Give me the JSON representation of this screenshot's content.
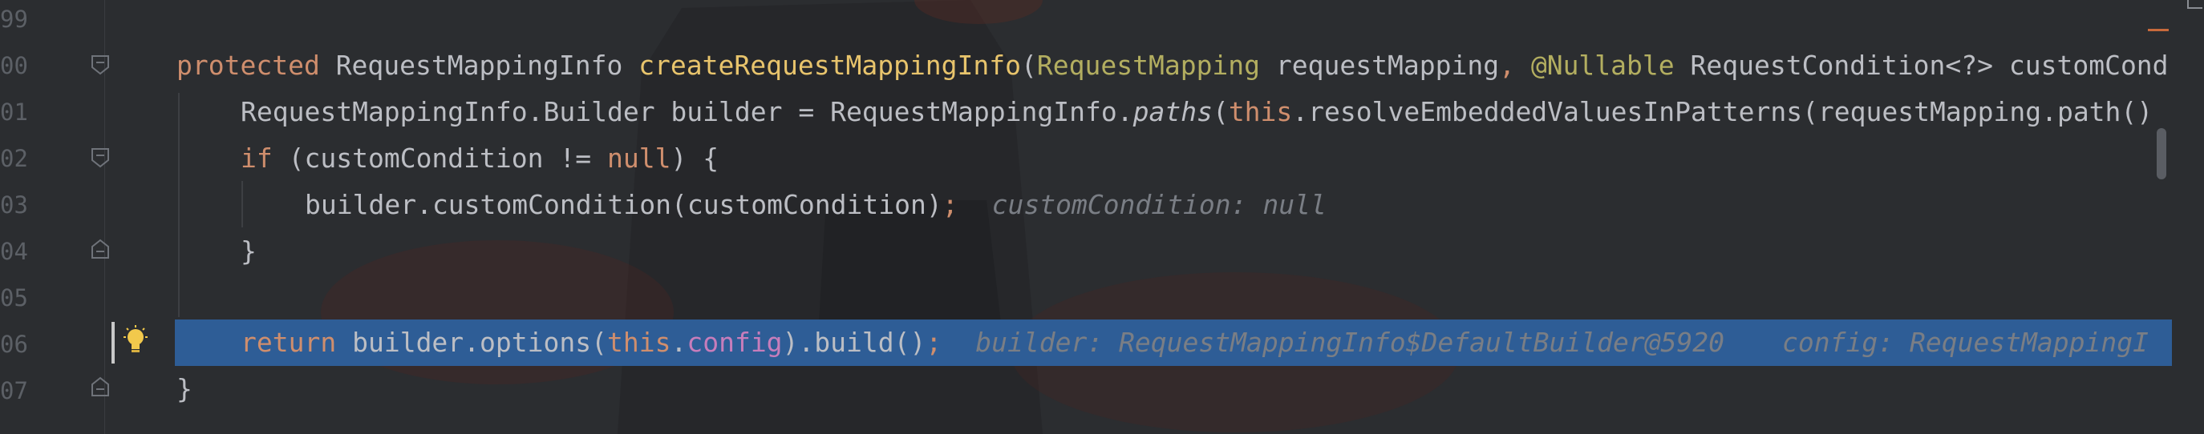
{
  "editor": {
    "line_numbers": [
      "99",
      "00",
      "01",
      "02",
      "03",
      "04",
      "05",
      "06",
      "07"
    ],
    "lines": {
      "l100": {
        "kw_protected": "protected",
        "type": "RequestMappingInfo",
        "method": "createRequestMappingInfo",
        "paren_open": "(",
        "param_type": "RequestMapping",
        "param_name": "requestMapping",
        "comma": ",",
        "annotation": "@Nullable",
        "rest": "RequestCondition<?> customCond"
      },
      "l101": {
        "a": "RequestMappingInfo.Builder builder = RequestMappingInfo.",
        "paths": "paths",
        "b": "(",
        "kw_this": "this",
        "c": ".resolveEmbeddedValuesInPatterns(requestMapping.path()"
      },
      "l102": {
        "kw_if": "if",
        "a": "(customCondition != ",
        "kw_null": "null",
        "b": ") {"
      },
      "l103": {
        "a": "builder.customCondition(customCondition)",
        "semi": ";",
        "hint": "customCondition: null"
      },
      "l104": {
        "a": "}"
      },
      "l106": {
        "kw_return": "return",
        "a": "builder.options(",
        "kw_this": "this",
        "dot": ".",
        "field": "config",
        "b": ").build()",
        "semi": ";",
        "hint1": "builder: RequestMappingInfo$DefaultBuilder@5920",
        "hint2": "config: RequestMappingI"
      },
      "l107": {
        "a": "}"
      }
    }
  },
  "colors": {
    "keyword": "#cf8e6d",
    "method": "#e8c46c",
    "annotation": "#b3ae60",
    "field": "#c77dbb",
    "inline_hint": "#7a7e85",
    "execution_line": "#2e5d96",
    "background": "#2b2d30"
  },
  "icons": {
    "gutter": [
      "fold-start-icon",
      "breakpoint-marker",
      "intention-bulb-icon"
    ],
    "corner": "window-corner-icon"
  }
}
